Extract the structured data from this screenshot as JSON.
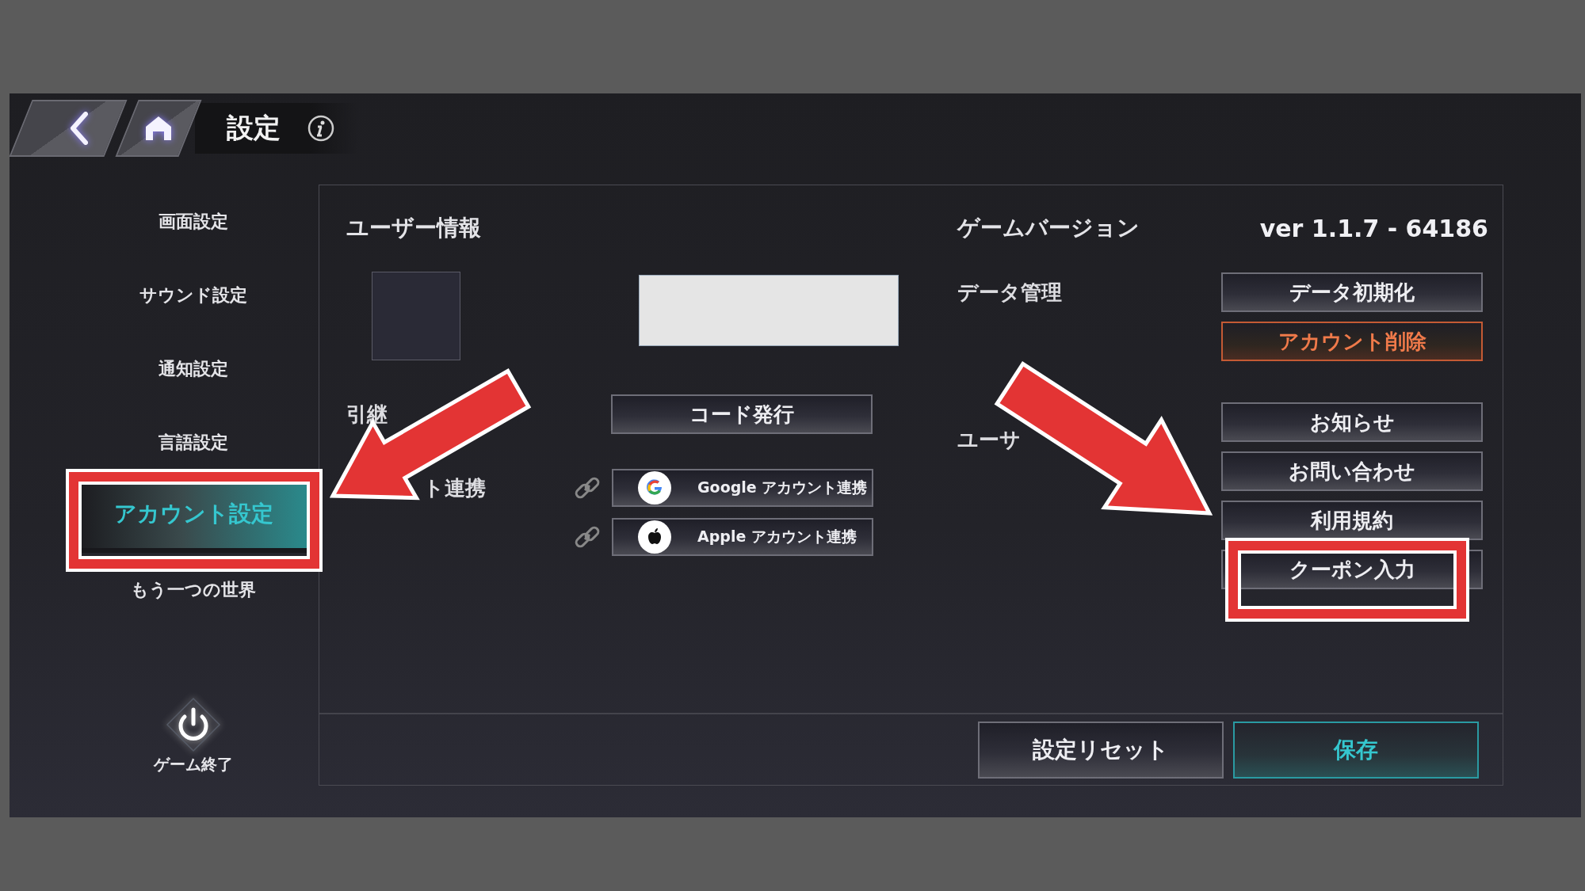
{
  "top_bar": {
    "title": "設定"
  },
  "sidebar": {
    "items": [
      {
        "label": "画面設定",
        "selected": false
      },
      {
        "label": "サウンド設定",
        "selected": false
      },
      {
        "label": "通知設定",
        "selected": false
      },
      {
        "label": "言語設定",
        "selected": false
      },
      {
        "label": "アカウント設定",
        "selected": true
      },
      {
        "label": "もう一つの世界",
        "selected": false
      }
    ],
    "exit_label": "ゲーム終了"
  },
  "user_info": {
    "title": "ユーザー情報",
    "handover_label": "引継",
    "code_button": "コード発行",
    "link_label": "ト連携",
    "link_buttons": [
      {
        "kind": "google",
        "label": "Google アカウント連携"
      },
      {
        "kind": "apple",
        "label": "Apple アカウント連携"
      }
    ]
  },
  "game_version": {
    "title": "ゲームバージョン",
    "value": "ver 1.1.7 - 64186"
  },
  "data_management": {
    "label": "データ管理",
    "buttons": [
      {
        "kind": "normal",
        "label": "データ初期化"
      },
      {
        "kind": "danger",
        "label": "アカウント削除"
      }
    ]
  },
  "support": {
    "label": "ユーサ",
    "buttons": [
      "お知らせ",
      "お問い合わせ",
      "利用規約",
      "クーポン入力"
    ]
  },
  "footer": {
    "buttons": [
      {
        "kind": "normal",
        "label": "設定リセット"
      },
      {
        "kind": "primary",
        "label": "保存"
      }
    ]
  }
}
